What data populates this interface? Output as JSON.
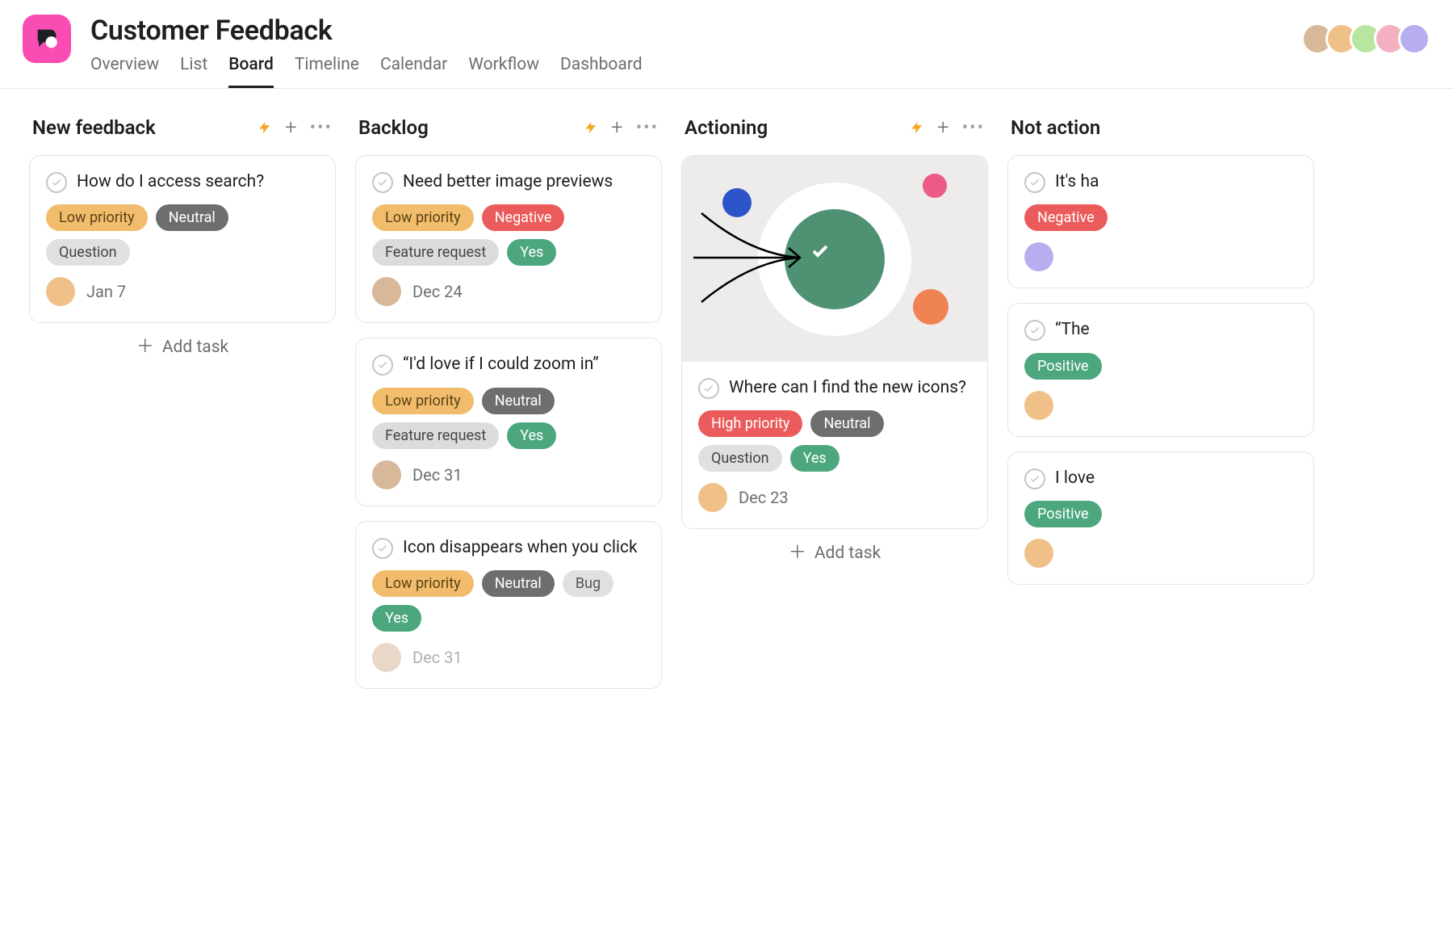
{
  "project": {
    "title": "Customer Feedback",
    "tabs": [
      "Overview",
      "List",
      "Board",
      "Timeline",
      "Calendar",
      "Workflow",
      "Dashboard"
    ],
    "active_tab": "Board"
  },
  "ui": {
    "add_task": "Add task"
  },
  "columns": [
    {
      "title": "New feedback",
      "cards": [
        {
          "title": "How do I access search?",
          "pills": [
            {
              "text": "Low priority",
              "cls": "p-low"
            },
            {
              "text": "Neutral",
              "cls": "p-neutral"
            },
            {
              "text": "Question",
              "cls": "p-question"
            }
          ],
          "date": "Jan 7",
          "assignee": "av-b"
        }
      ],
      "show_add": true
    },
    {
      "title": "Backlog",
      "cards": [
        {
          "title": "Need better image previews",
          "pills": [
            {
              "text": "Low priority",
              "cls": "p-low"
            },
            {
              "text": "Negative",
              "cls": "p-negative"
            },
            {
              "text": "Feature request",
              "cls": "p-feature"
            },
            {
              "text": "Yes",
              "cls": "p-yes"
            }
          ],
          "date": "Dec 24",
          "assignee": "av-a"
        },
        {
          "title": "“I'd love if I could zoom in”",
          "pills": [
            {
              "text": "Low priority",
              "cls": "p-low"
            },
            {
              "text": "Neutral",
              "cls": "p-neutral"
            },
            {
              "text": "Feature request",
              "cls": "p-feature"
            },
            {
              "text": "Yes",
              "cls": "p-yes"
            }
          ],
          "date": "Dec 31",
          "assignee": "av-a"
        },
        {
          "title": "Icon disappears when you click",
          "pills": [
            {
              "text": "Low priority",
              "cls": "p-low"
            },
            {
              "text": "Neutral",
              "cls": "p-neutral"
            },
            {
              "text": "Bug",
              "cls": "p-bug"
            },
            {
              "text": "Yes",
              "cls": "p-yes"
            }
          ],
          "date": "Dec 31",
          "assignee": "av-a",
          "faded": true
        }
      ]
    },
    {
      "title": "Actioning",
      "cards": [
        {
          "cover": true,
          "title": "Where can I find the new icons?",
          "pills": [
            {
              "text": "High priority",
              "cls": "p-high"
            },
            {
              "text": "Neutral",
              "cls": "p-neutral"
            },
            {
              "text": "Question",
              "cls": "p-question"
            },
            {
              "text": "Yes",
              "cls": "p-yes"
            }
          ],
          "date": "Dec 23",
          "assignee": "av-b"
        }
      ],
      "show_add": true
    },
    {
      "title": "Not action",
      "no_actions": true,
      "cards": [
        {
          "title": "It's ha",
          "pills": [
            {
              "text": "Negative",
              "cls": "p-negative"
            }
          ],
          "assignee": "av-e"
        },
        {
          "title": "“The",
          "pills": [
            {
              "text": "Positive",
              "cls": "p-positive"
            }
          ],
          "assignee": "av-b"
        },
        {
          "title": "I love",
          "pills": [
            {
              "text": "Positive",
              "cls": "p-positive"
            }
          ],
          "assignee": "av-b"
        }
      ]
    }
  ]
}
